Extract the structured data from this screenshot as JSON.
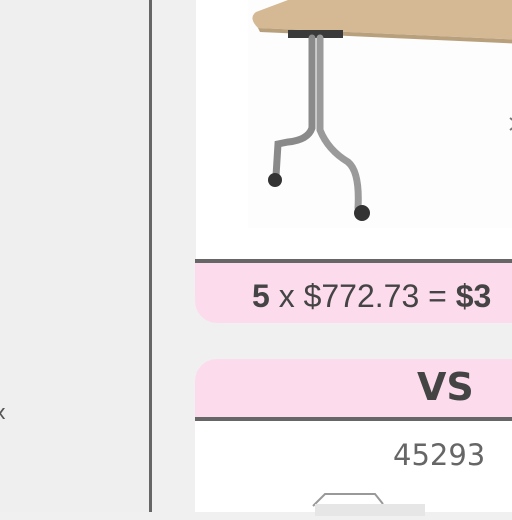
{
  "left_panel": {
    "edge_glyph": "x"
  },
  "product": {
    "image_icon": "folding-table-icon",
    "quantity": "5",
    "times": "x",
    "unit_price": "$772.73",
    "equals": "=",
    "total_partial": "$3"
  },
  "compare": {
    "label": "VS",
    "item_id": "45293",
    "image_icon": "cart-item-icon"
  },
  "colors": {
    "accent_pink": "#fcdcec",
    "divider": "#666666",
    "text": "#444444"
  }
}
